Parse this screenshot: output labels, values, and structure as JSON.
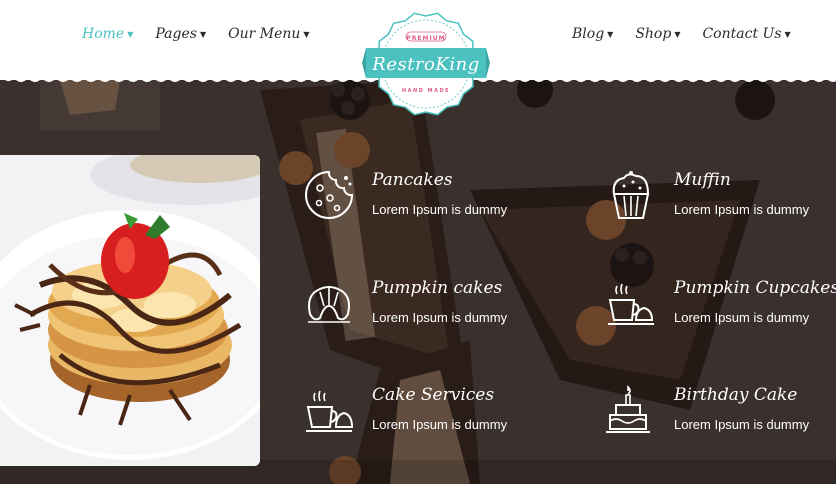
{
  "header": {
    "nav_left": [
      {
        "label": "Home",
        "active": true
      },
      {
        "label": "Pages",
        "active": false
      },
      {
        "label": "Our Menu",
        "active": false
      }
    ],
    "nav_right": [
      {
        "label": "Blog",
        "active": false
      },
      {
        "label": "Shop",
        "active": false
      },
      {
        "label": "Contact Us",
        "active": false
      }
    ],
    "chevron_icon": "chevron-down-icon"
  },
  "logo": {
    "top_text": "PREMIUM",
    "brand": "RestroKing",
    "bottom_text": "HAND MADE"
  },
  "colors": {
    "accent": "#4cc2c0",
    "logo_pink": "#e05c8a",
    "background_dark": "#2c2422",
    "text_white": "#ffffff"
  },
  "features": [
    {
      "title": "Pancakes",
      "text": "Lorem Ipsum is dummy",
      "icon": "cookie-icon"
    },
    {
      "title": "Muffin",
      "text": "Lorem Ipsum is dummy",
      "icon": "muffin-icon"
    },
    {
      "title": "Pumpkin cakes",
      "text": "Lorem Ipsum is dummy",
      "icon": "croissant-icon"
    },
    {
      "title": "Pumpkin Cupcakes",
      "text": "Lorem Ipsum is dummy",
      "icon": "coffee-croissant-icon"
    },
    {
      "title": "Cake Services",
      "text": "Lorem Ipsum is dummy",
      "icon": "coffee-cup-icon"
    },
    {
      "title": "Birthday Cake",
      "text": "Lorem Ipsum is dummy",
      "icon": "birthday-cake-icon"
    }
  ],
  "food_image": "pancake-stack-with-strawberry"
}
